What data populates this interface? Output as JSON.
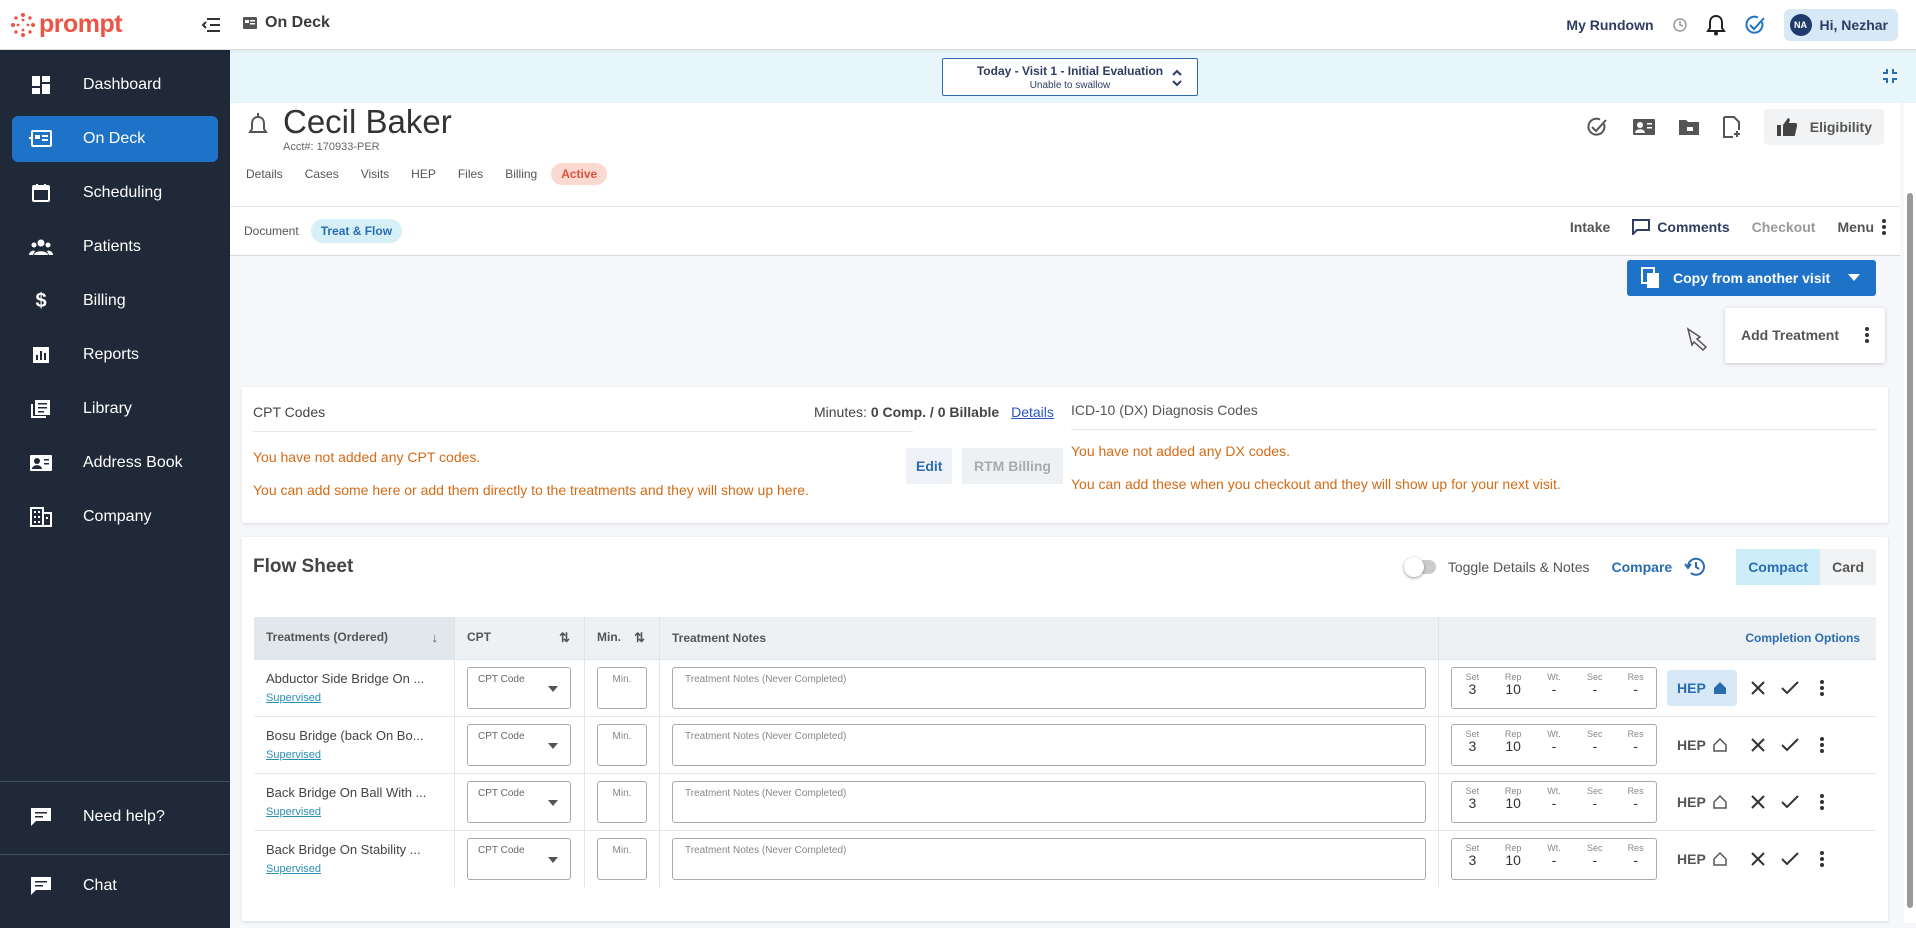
{
  "app": {
    "logo_text": "prompt",
    "breadcrumb": "On Deck",
    "my_rundown": "My Rundown",
    "user_initials": "NA",
    "user_greeting": "Hi, Nezhar"
  },
  "sidebar": {
    "items": [
      {
        "label": "Dashboard",
        "icon": "dashboard-icon"
      },
      {
        "label": "On Deck",
        "icon": "on-deck-icon",
        "active": true
      },
      {
        "label": "Scheduling",
        "icon": "calendar-icon"
      },
      {
        "label": "Patients",
        "icon": "patients-icon"
      },
      {
        "label": "Billing",
        "icon": "dollar-icon"
      },
      {
        "label": "Reports",
        "icon": "reports-icon"
      },
      {
        "label": "Library",
        "icon": "library-icon"
      },
      {
        "label": "Address Book",
        "icon": "address-book-icon"
      },
      {
        "label": "Company",
        "icon": "company-icon"
      }
    ],
    "help": "Need help?",
    "chat": "Chat"
  },
  "visit": {
    "title": "Today - Visit 1 - Initial Evaluation",
    "subtitle": "Unable to swallow"
  },
  "patient": {
    "name": "Cecil Baker",
    "acct": "Acct#: 170933-PER",
    "tabs": [
      "Details",
      "Cases",
      "Visits",
      "HEP",
      "Files",
      "Billing"
    ],
    "status": "Active",
    "eligibility": "Eligibility"
  },
  "doc_tabs": {
    "document": "Document",
    "treat_flow": "Treat & Flow",
    "intake": "Intake",
    "comments": "Comments",
    "checkout": "Checkout",
    "menu": "Menu"
  },
  "actions": {
    "copy_visit": "Copy from another visit",
    "add_treatment": "Add Treatment"
  },
  "cpt": {
    "title": "CPT Codes",
    "minutes_label": "Minutes:",
    "minutes_value": "0 Comp. / 0 Billable",
    "details_link": "Details",
    "empty_1": "You have not added any CPT codes.",
    "empty_2": "You can add some here or add them directly to the treatments and they will show up here.",
    "edit": "Edit",
    "rtm": "RTM Billing"
  },
  "dx": {
    "title": "ICD-10 (DX) Diagnosis Codes",
    "empty_1": "You have not added any DX codes.",
    "empty_2": "You can add these when you checkout and they will show up for your next visit."
  },
  "flow": {
    "title": "Flow Sheet",
    "toggle_label": "Toggle Details & Notes",
    "compare": "Compare",
    "compact": "Compact",
    "card": "Card",
    "headers": {
      "treatments": "Treatments (Ordered)",
      "cpt": "CPT",
      "min": "Min.",
      "notes": "Treatment Notes",
      "completion": "Completion Options"
    },
    "placeholders": {
      "cpt": "CPT Code",
      "min": "Min.",
      "notes": "Treatment Notes (Never Completed)"
    },
    "srwsr_labels": [
      "Set",
      "Rep",
      "Wt.",
      "Sec",
      "Res"
    ],
    "hep_label": "HEP",
    "rows": [
      {
        "name": "Abductor Side Bridge On ...",
        "mode": "Supervised",
        "set": "3",
        "rep": "10",
        "wt": "-",
        "sec": "-",
        "res": "-",
        "hep_active": true
      },
      {
        "name": "Bosu Bridge (back On Bo...",
        "mode": "Supervised",
        "set": "3",
        "rep": "10",
        "wt": "-",
        "sec": "-",
        "res": "-",
        "hep_active": false
      },
      {
        "name": "Back Bridge On Ball With ...",
        "mode": "Supervised",
        "set": "3",
        "rep": "10",
        "wt": "-",
        "sec": "-",
        "res": "-",
        "hep_active": false
      },
      {
        "name": "Back Bridge On Stability ...",
        "mode": "Supervised",
        "set": "3",
        "rep": "10",
        "wt": "-",
        "sec": "-",
        "res": "-",
        "hep_active": false
      }
    ]
  },
  "colors": {
    "brand": "#ea5545",
    "sidebar": "#1f2937",
    "active_nav": "#1e73c8",
    "empty_text": "#d36b16"
  }
}
